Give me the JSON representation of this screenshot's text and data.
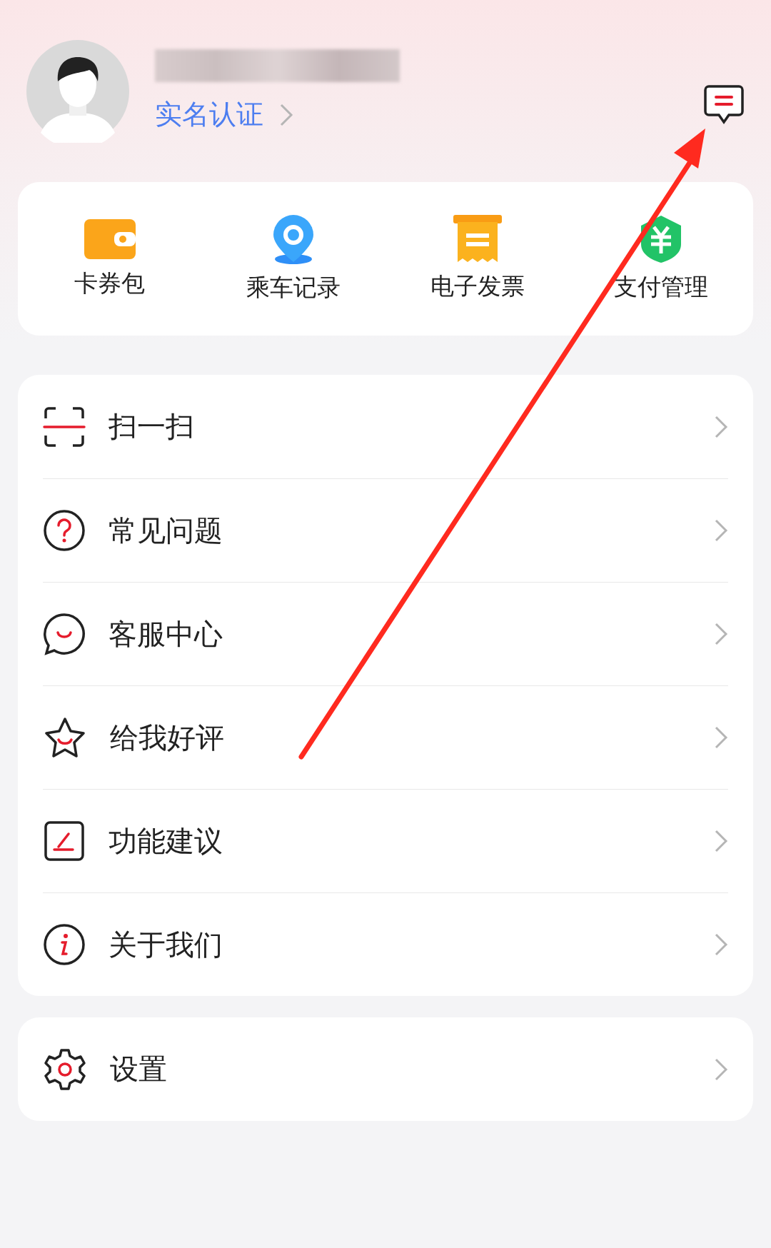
{
  "header": {
    "verify_link": "实名认证"
  },
  "shortcuts": [
    {
      "label": "卡券包",
      "kind": "wallet"
    },
    {
      "label": "乘车记录",
      "kind": "pin"
    },
    {
      "label": "电子发票",
      "kind": "invoice"
    },
    {
      "label": "支付管理",
      "kind": "shield"
    }
  ],
  "menu": [
    {
      "label": "扫一扫",
      "kind": "scan"
    },
    {
      "label": "常见问题",
      "kind": "question"
    },
    {
      "label": "客服中心",
      "kind": "chat"
    },
    {
      "label": "给我好评",
      "kind": "star"
    },
    {
      "label": "功能建议",
      "kind": "edit"
    },
    {
      "label": "关于我们",
      "kind": "info"
    }
  ],
  "settings": [
    {
      "label": "设置",
      "kind": "gear"
    }
  ]
}
